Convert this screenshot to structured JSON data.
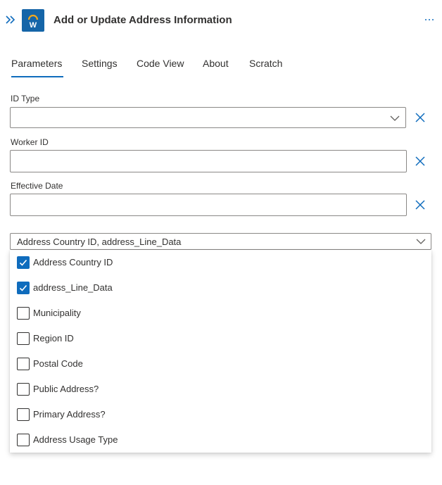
{
  "header": {
    "title": "Add or Update Address Information",
    "logo_letter": "W",
    "collapse_icon": "double-chevron-right-icon",
    "more_icon": "ellipsis-icon",
    "logo_color": "#1565a8"
  },
  "tabs": [
    {
      "label": "Parameters",
      "active": true
    },
    {
      "label": "Settings",
      "active": false
    },
    {
      "label": "Code View",
      "active": false
    },
    {
      "label": "About",
      "active": false
    },
    {
      "label": "Scratch",
      "active": false
    }
  ],
  "fields": {
    "id_type": {
      "label": "ID Type",
      "value": ""
    },
    "worker_id": {
      "label": "Worker ID",
      "value": ""
    },
    "effective_date": {
      "label": "Effective Date",
      "value": ""
    }
  },
  "advanced_params": {
    "selected_text": "Address Country ID, address_Line_Data",
    "options": [
      {
        "label": "Address Country ID",
        "checked": true
      },
      {
        "label": "address_Line_Data",
        "checked": true
      },
      {
        "label": "Municipality",
        "checked": false
      },
      {
        "label": "Region ID",
        "checked": false
      },
      {
        "label": "Postal Code",
        "checked": false
      },
      {
        "label": "Public Address?",
        "checked": false
      },
      {
        "label": "Primary Address?",
        "checked": false
      },
      {
        "label": "Address Usage Type",
        "checked": false
      }
    ]
  },
  "colors": {
    "accent": "#0f6cbd",
    "text": "#323130",
    "border": "#8a8886"
  }
}
